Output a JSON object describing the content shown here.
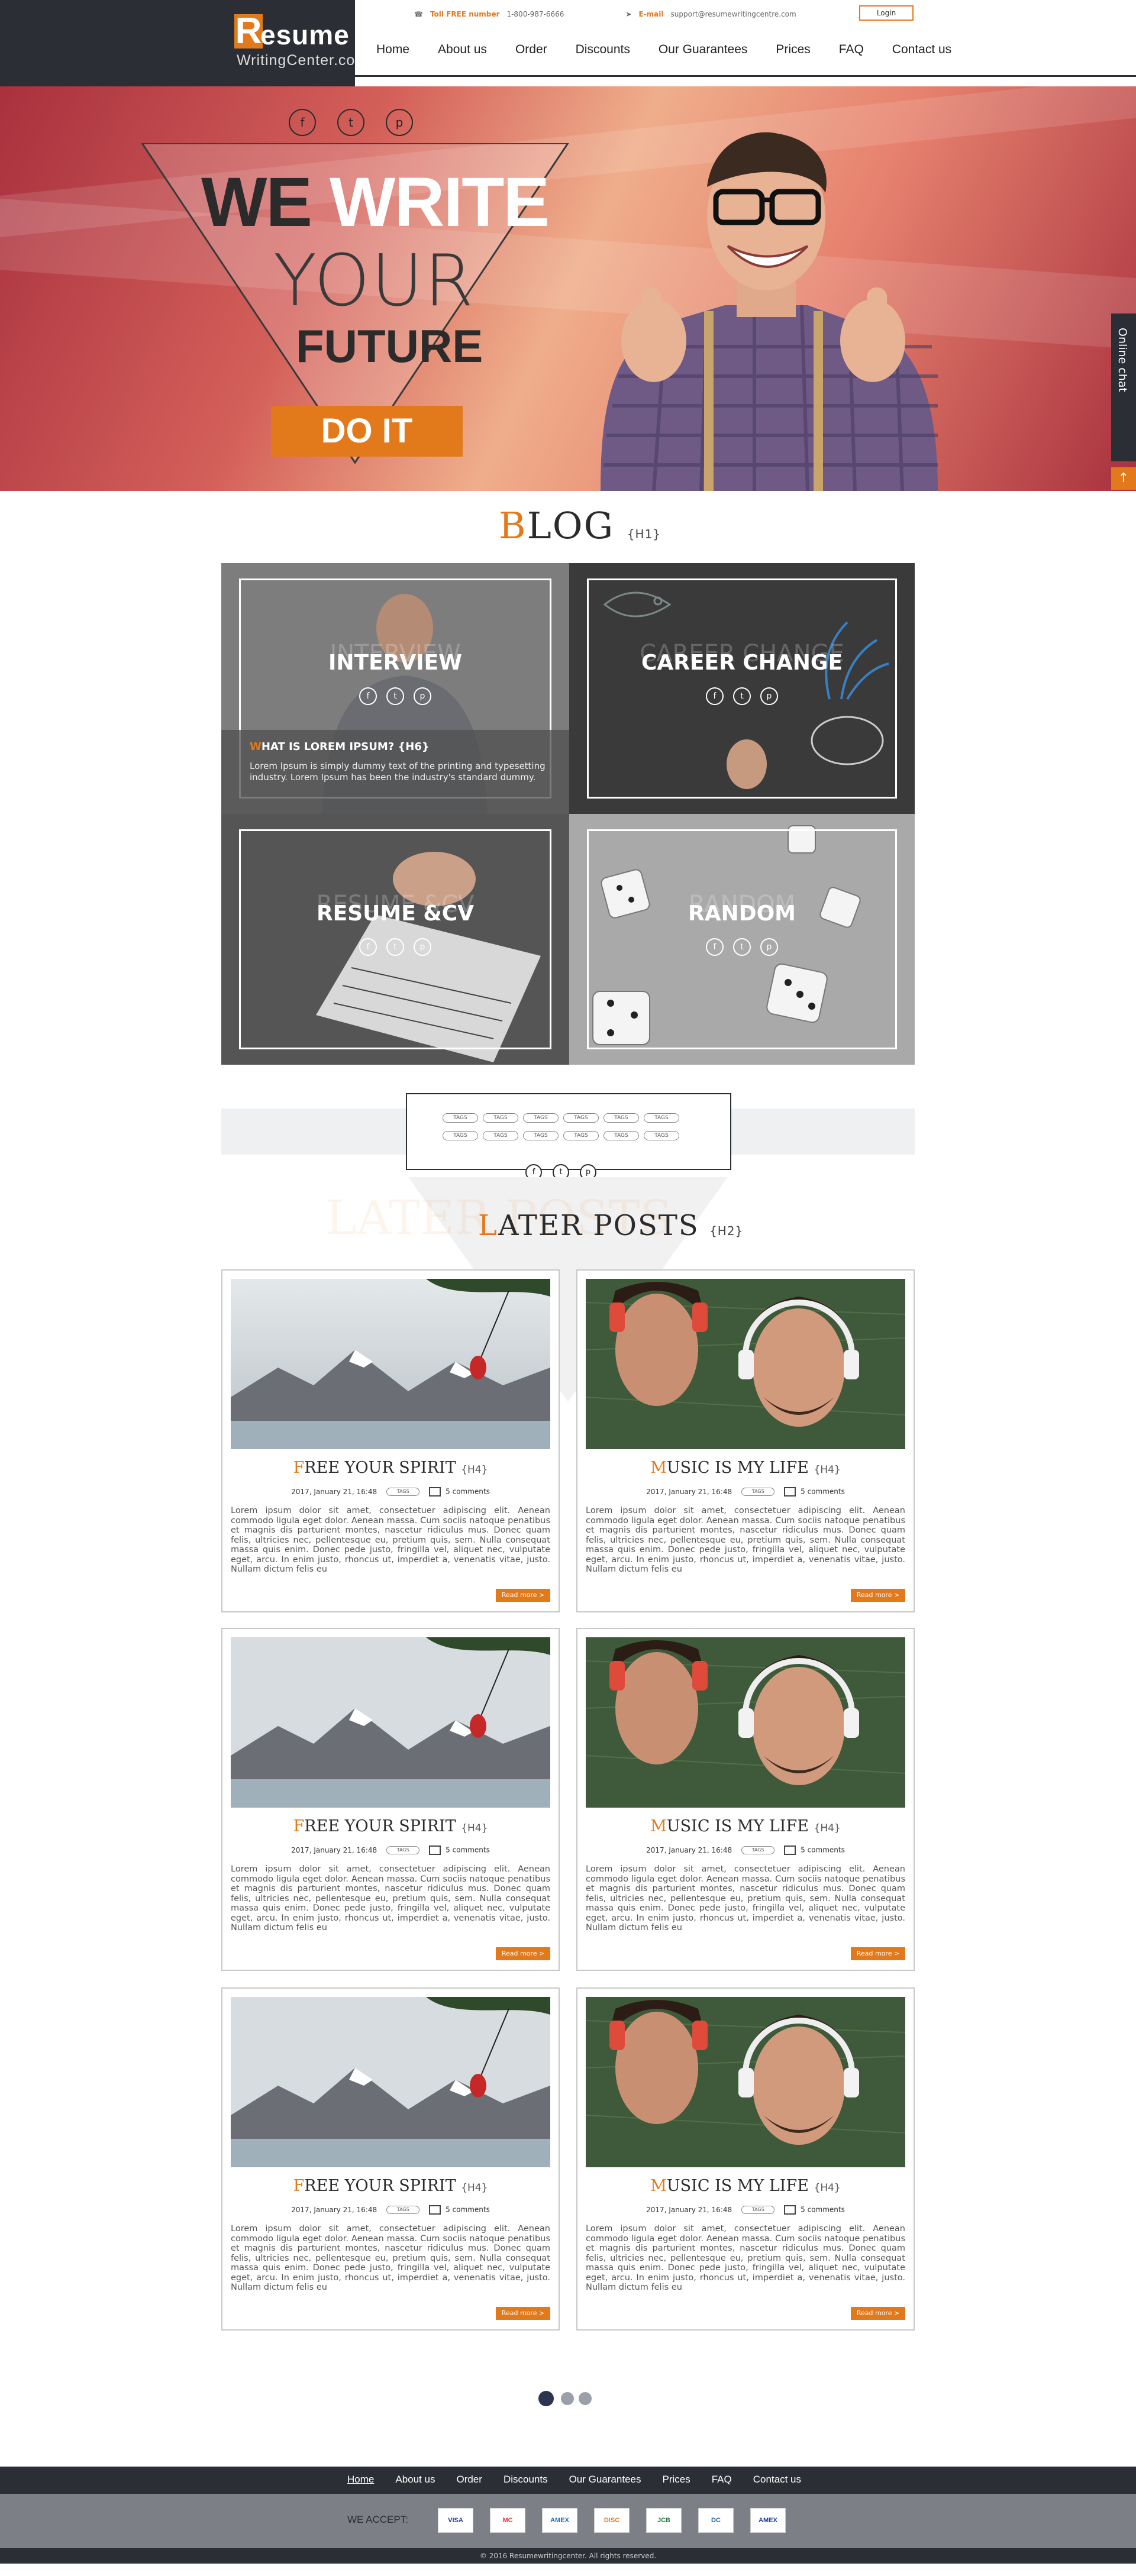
{
  "header": {
    "logo_letter": "R",
    "logo_main": "esume",
    "logo_sub": "WritingCenter.com",
    "tollfree_label": "Toll FREE number",
    "tollfree_value": "1-800-987-6666",
    "email_label": "E-mail",
    "email_value": "support@resumewritingcentre.com",
    "login": "Login",
    "nav": [
      "Home",
      "About us",
      "Order",
      "Discounts",
      "Our Guarantees",
      "Prices",
      "FAQ",
      "Contact us"
    ]
  },
  "hero": {
    "social": [
      "f",
      "t",
      "p"
    ],
    "title_we": "WE ",
    "title_write": "WRITE",
    "title_your": "YOUR",
    "title_future": "FUTURE",
    "cta": "DO IT",
    "chat": "Online chat",
    "up": "↑"
  },
  "blog": {
    "first": "B",
    "rest": "LOG",
    "tag": "{H1}",
    "tiles": [
      {
        "ghost": "INTERVIEW",
        "name": "INTERVIEW"
      },
      {
        "ghost": "CAREER CHANGE",
        "name": "CAREER CHANGE"
      },
      {
        "ghost": "RESUME &CV",
        "name": "RESUME &CV"
      },
      {
        "ghost": "RANDOM",
        "name": "RANDOM"
      }
    ],
    "overlay_first": "W",
    "overlay_head": "HAT IS LOREM IPSUM? {H6}",
    "overlay_text": "Lorem Ipsum is simply dummy text of the printing and typesetting industry. Lorem Ipsum has been the industry's standard dummy.",
    "tags": [
      "TAGS",
      "TAGS",
      "TAGS",
      "TAGS",
      "TAGS",
      "TAGS"
    ]
  },
  "later": {
    "ghost": "LATER POSTS",
    "first": "L",
    "rest": "ATER POSTS",
    "tag": "{H2}",
    "posts": [
      {
        "first": "F",
        "rest": "REE YOUR SPIRIT",
        "h": "{H4}",
        "date": "2017, January 21, 16:48",
        "tag": "TAGS",
        "comments": "5 comments",
        "body": "Lorem ipsum dolor sit amet, consectetuer adipiscing elit. Aenean commodo ligula eget dolor. Aenean massa. Cum sociis natoque penatibus et magnis dis parturient montes, nascetur ridiculus mus. Donec quam felis, ultricies nec, pellentesque eu, pretium quis, sem. Nulla consequat massa quis enim. Donec pede justo, fringilla vel, aliquet nec, vulputate eget, arcu. In enim justo, rhoncus ut, imperdiet a, venenatis vitae, justo. Nullam dictum felis eu",
        "more": "Read more >"
      },
      {
        "first": "M",
        "rest": "USIC IS MY LIFE",
        "h": "{H4}",
        "date": "2017, January 21, 16:48",
        "tag": "TAGS",
        "comments": "5 comments",
        "body": "Lorem ipsum dolor sit amet, consectetuer adipiscing elit. Aenean commodo ligula eget dolor. Aenean massa. Cum sociis natoque penatibus et magnis dis parturient montes, nascetur ridiculus mus. Donec quam felis, ultricies nec, pellentesque eu, pretium quis, sem. Nulla consequat massa quis enim. Donec pede justo, fringilla vel, aliquet nec, vulputate eget, arcu. In enim justo, rhoncus ut, imperdiet a, venenatis vitae, justo. Nullam dictum felis eu",
        "more": "Read more >"
      },
      {
        "first": "F",
        "rest": "REE YOUR SPIRIT",
        "h": "{H4}",
        "date": "2017, January 21, 16:48",
        "tag": "TAGS",
        "comments": "5 comments",
        "body": "Lorem ipsum dolor sit amet, consectetuer adipiscing elit. Aenean commodo ligula eget dolor. Aenean massa. Cum sociis natoque penatibus et magnis dis parturient montes, nascetur ridiculus mus. Donec quam felis, ultricies nec, pellentesque eu, pretium quis, sem. Nulla consequat massa quis enim. Donec pede justo, fringilla vel, aliquet nec, vulputate eget, arcu. In enim justo, rhoncus ut, imperdiet a, venenatis vitae, justo. Nullam dictum felis eu",
        "more": "Read more >"
      },
      {
        "first": "M",
        "rest": "USIC IS MY LIFE",
        "h": "{H4}",
        "date": "2017, January 21, 16:48",
        "tag": "TAGS",
        "comments": "5 comments",
        "body": "Lorem ipsum dolor sit amet, consectetuer adipiscing elit. Aenean commodo ligula eget dolor. Aenean massa. Cum sociis natoque penatibus et magnis dis parturient montes, nascetur ridiculus mus. Donec quam felis, ultricies nec, pellentesque eu, pretium quis, sem. Nulla consequat massa quis enim. Donec pede justo, fringilla vel, aliquet nec, vulputate eget, arcu. In enim justo, rhoncus ut, imperdiet a, venenatis vitae, justo. Nullam dictum felis eu",
        "more": "Read more >"
      },
      {
        "first": "F",
        "rest": "REE YOUR SPIRIT",
        "h": "{H4}",
        "date": "2017, January 21, 16:48",
        "tag": "TAGS",
        "comments": "5 comments",
        "body": "Lorem ipsum dolor sit amet, consectetuer adipiscing elit. Aenean commodo ligula eget dolor. Aenean massa. Cum sociis natoque penatibus et magnis dis parturient montes, nascetur ridiculus mus. Donec quam felis, ultricies nec, pellentesque eu, pretium quis, sem. Nulla consequat massa quis enim. Donec pede justo, fringilla vel, aliquet nec, vulputate eget, arcu. In enim justo, rhoncus ut, imperdiet a, venenatis vitae, justo. Nullam dictum felis eu",
        "more": "Read more >"
      },
      {
        "first": "M",
        "rest": "USIC IS MY LIFE",
        "h": "{H4}",
        "date": "2017, January 21, 16:48",
        "tag": "TAGS",
        "comments": "5 comments",
        "body": "Lorem ipsum dolor sit amet, consectetuer adipiscing elit. Aenean commodo ligula eget dolor. Aenean massa. Cum sociis natoque penatibus et magnis dis parturient montes, nascetur ridiculus mus. Donec quam felis, ultricies nec, pellentesque eu, pretium quis, sem. Nulla consequat massa quis enim. Donec pede justo, fringilla vel, aliquet nec, vulputate eget, arcu. In enim justo, rhoncus ut, imperdiet a, venenatis vitae, justo. Nullam dictum felis eu",
        "more": "Read more >"
      }
    ]
  },
  "footer": {
    "nav": [
      "Home",
      "About us",
      "Order",
      "Discounts",
      "Our Guarantees",
      "Prices",
      "FAQ",
      "Contact us"
    ],
    "we_accept": "WE ACCEPT:",
    "cards": [
      "VISA",
      "MC",
      "AMEX",
      "DISC",
      "JCB",
      "DC",
      "AMEX"
    ],
    "copyright": "© 2016 Resumewritingcenter. All rights reserved."
  },
  "colors": {
    "accent": "#e27a1b",
    "dark": "#2b2e35"
  }
}
